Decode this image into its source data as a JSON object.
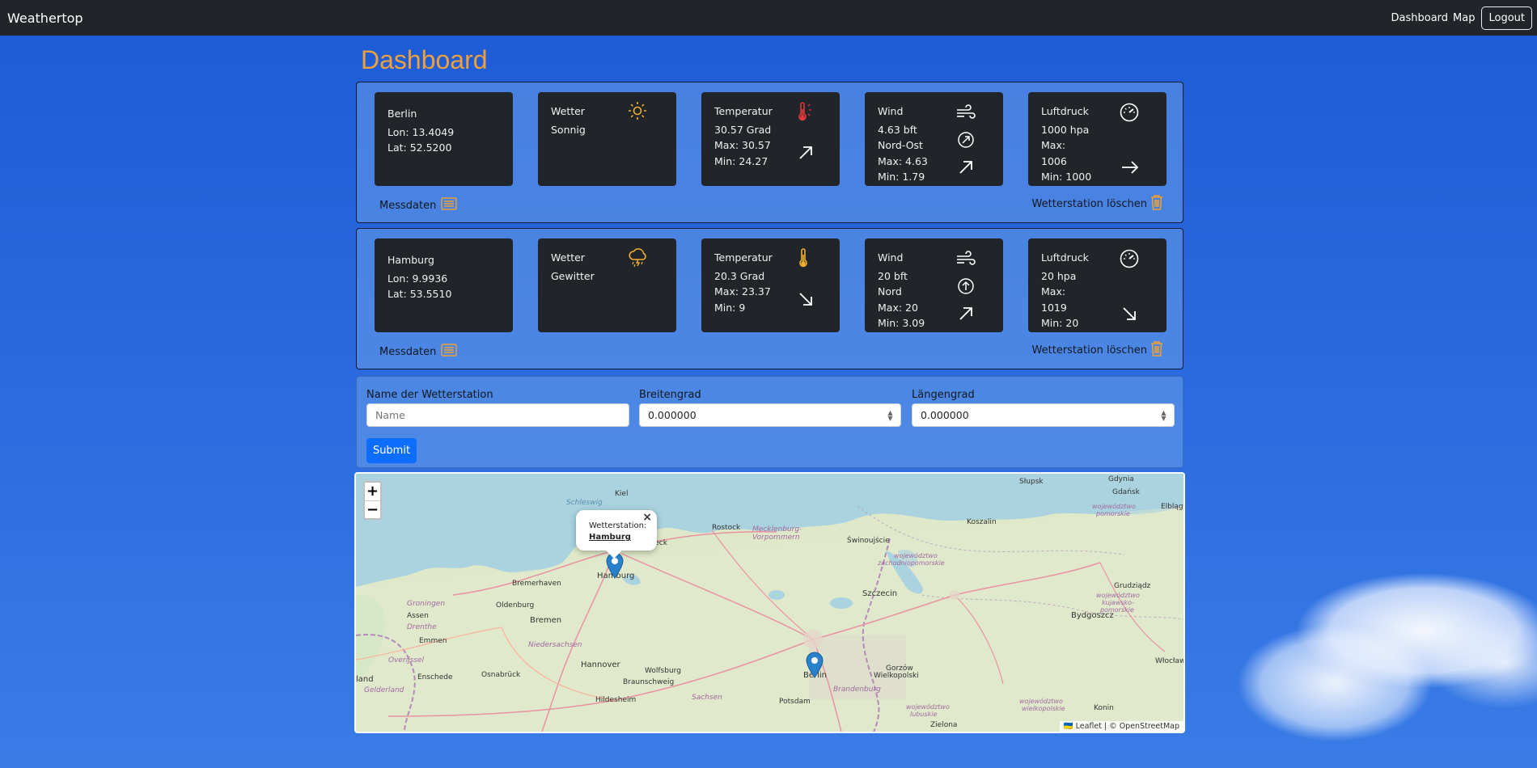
{
  "navbar": {
    "brand": "Weathertop",
    "links": [
      "Dashboard",
      "Map"
    ],
    "logout": "Logout"
  },
  "page": {
    "title": "Dashboard"
  },
  "stations": [
    {
      "name": "Berlin",
      "lon": "Lon: 13.4049",
      "lat": "Lat: 52.5200",
      "weather_title": "Wetter",
      "weather": "Sonnig",
      "weather_icon": "sun-icon",
      "temp_title": "Temperatur",
      "temp": "30.57 Grad",
      "temp_max": "Max: 30.57",
      "temp_min": "Min: 24.27",
      "temp_icon": "thermometer-hot-icon",
      "temp_trend": "arrow-up-right-icon",
      "wind_title": "Wind",
      "wind": "4.63 bft",
      "wind_dir": "Nord-Ost",
      "wind_max": "Max: 4.63",
      "wind_min": "Min: 1.79",
      "wind_trend": "arrow-up-right-icon",
      "pressure_title": "Luftdruck",
      "pressure": "1000 hpa",
      "pressure_max_label": "Max:",
      "pressure_max": "1006",
      "pressure_min": "Min: 1000",
      "pressure_trend": "arrow-right-icon",
      "measurements": "Messdaten",
      "delete": "Wetterstation löschen"
    },
    {
      "name": "Hamburg",
      "lon": "Lon: 9.9936",
      "lat": "Lat: 53.5510",
      "weather_title": "Wetter",
      "weather": "Gewitter",
      "weather_icon": "cloud-lightning-rain-icon",
      "temp_title": "Temperatur",
      "temp": "20.3 Grad",
      "temp_max": "Max: 23.37",
      "temp_min": "Min: 9",
      "temp_icon": "thermometer-icon",
      "temp_trend": "arrow-down-right-icon",
      "wind_title": "Wind",
      "wind": "20 bft",
      "wind_dir": "Nord",
      "wind_max": "Max: 20",
      "wind_min": "Min: 3.09",
      "wind_trend": "arrow-up-right-icon",
      "pressure_title": "Luftdruck",
      "pressure": "20 hpa",
      "pressure_max_label": "Max:",
      "pressure_max": "1019",
      "pressure_min": "Min: 20",
      "pressure_trend": "arrow-down-right-icon",
      "measurements": "Messdaten",
      "delete": "Wetterstation löschen"
    }
  ],
  "form": {
    "name_label": "Name der Wetterstation",
    "name_placeholder": "Name",
    "lat_label": "Breitengrad",
    "lat_value": "0.000000",
    "lon_label": "Längengrad",
    "lon_value": "0.000000",
    "submit": "Submit"
  },
  "map": {
    "zoom_in": "+",
    "zoom_out": "−",
    "popup_prefix": "Wetterstation:",
    "popup_station": "Hamburg",
    "popup_close": "×",
    "attribution": "🇺🇦 Leaflet | © OpenStreetMap",
    "labels": {
      "kiel": "Kiel",
      "schleswig": "Schleswig",
      "rostock": "Rostock",
      "mecklenburg": "Mecklenburg-",
      "vorpommern": "Vorpommern",
      "swinoujscie": "Świnoujście",
      "koszalin": "Koszalin",
      "slupsk": "Słupsk",
      "gdynia": "Gdynia",
      "gdansk": "Gdańsk",
      "elblag": "Elbląg",
      "pomorskie1": "województwo",
      "pomorskie2": "pomorskie",
      "zachodnio1": "województwo",
      "zachodnio2": "zachodniopomorskie",
      "kujawsko1": "województwo",
      "kujawsko2": "kujawsko-",
      "kujawsko3": "pomorskie",
      "lubeck": "Lübeck",
      "hamburg": "Hamburg",
      "bremerhaven": "Bremerhaven",
      "oldenburg": "Oldenburg",
      "bremen": "Bremen",
      "groningen": "Groningen",
      "assen": "Assen",
      "drenthe": "Drenthe",
      "emmen": "Emmen",
      "niedersachsen": "Niedersachsen",
      "overijssel": "Overijssel",
      "enschede": "Enschede",
      "osnabruck": "Osnabrück",
      "hannover": "Hannover",
      "wolfsburg": "Wolfsburg",
      "braunschweig": "Braunschweig",
      "hildesheim": "Hildesheim",
      "sachsen": "Sachsen",
      "gelderland": "Gelderland",
      "land": "land",
      "szczecin": "Szczecin",
      "bydgoszcz": "Bydgoszcz",
      "grudziadz": "Grudziądz",
      "wloclawek": "Włocławek",
      "berlin": "Berlin",
      "potsdam": "Potsdam",
      "brandenburg": "Brandenburg",
      "gorzow1": "Gorzów",
      "gorzow2": "Wielkopolski",
      "lubuskie1": "województwo",
      "lubuskie2": "lubuskie",
      "wielko1": "województwo",
      "wielko2": "wielkopolskie",
      "konin": "Konin",
      "zielona": "Zielona"
    }
  }
}
